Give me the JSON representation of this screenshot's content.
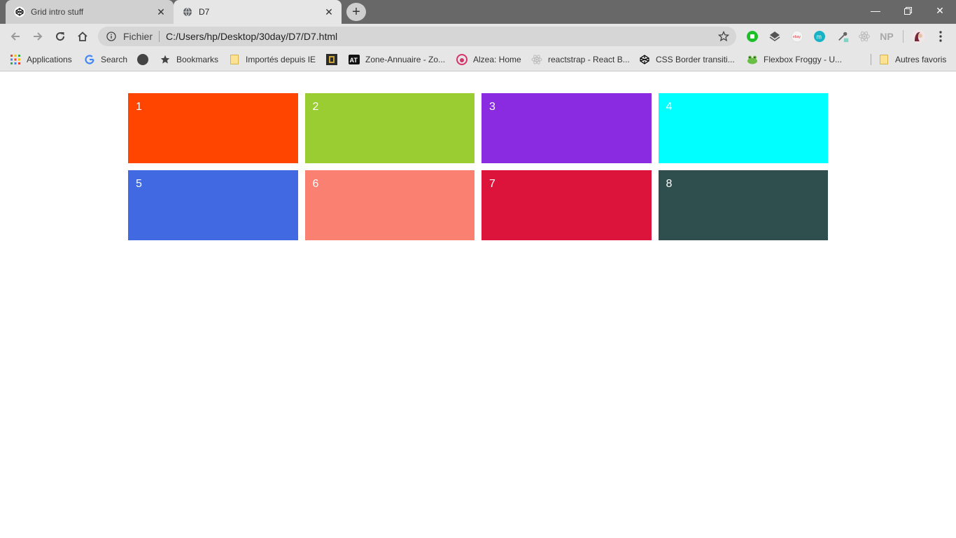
{
  "tabs": [
    {
      "title": "Grid intro stuff",
      "favicon": "codepen-icon",
      "active": false
    },
    {
      "title": "D7",
      "favicon": "globe-icon",
      "active": true
    }
  ],
  "toolbar": {
    "scheme": "Fichier",
    "url": "C:/Users/hp/Desktop/30day/D7/D7.html",
    "extensions": [
      "green-extension-icon",
      "layers-icon",
      "ebay-icon",
      "m-icon",
      "eyedropper-icon",
      "react-icon",
      "NP"
    ]
  },
  "bookmarks": {
    "apps": "Applications",
    "items": [
      {
        "label": "Search",
        "icon": "google-icon"
      },
      {
        "label": "",
        "icon": "dark-circle-icon"
      },
      {
        "label": "Bookmarks",
        "icon": "star-icon"
      },
      {
        "label": "Importés depuis IE",
        "icon": "folder-icon"
      },
      {
        "label": "",
        "icon": "square-icon"
      },
      {
        "label": "Zone-Annuaire - Zo...",
        "icon": "at-icon"
      },
      {
        "label": "Alzea: Home",
        "icon": "alzea-icon"
      },
      {
        "label": "reactstrap - React B...",
        "icon": "react-icon"
      },
      {
        "label": "CSS Border transiti...",
        "icon": "codepen-icon"
      },
      {
        "label": "Flexbox Froggy - U...",
        "icon": "frog-icon"
      }
    ],
    "other": "Autres favoris"
  },
  "grid": {
    "cells": [
      {
        "label": "1",
        "color": "#FF4500"
      },
      {
        "label": "2",
        "color": "#9ACD32"
      },
      {
        "label": "3",
        "color": "#8A2BE2"
      },
      {
        "label": "4",
        "color": "#00FFFF"
      },
      {
        "label": "5",
        "color": "#4169E1"
      },
      {
        "label": "6",
        "color": "#FA8072"
      },
      {
        "label": "7",
        "color": "#DC143C"
      },
      {
        "label": "8",
        "color": "#2F4F4F"
      }
    ]
  }
}
